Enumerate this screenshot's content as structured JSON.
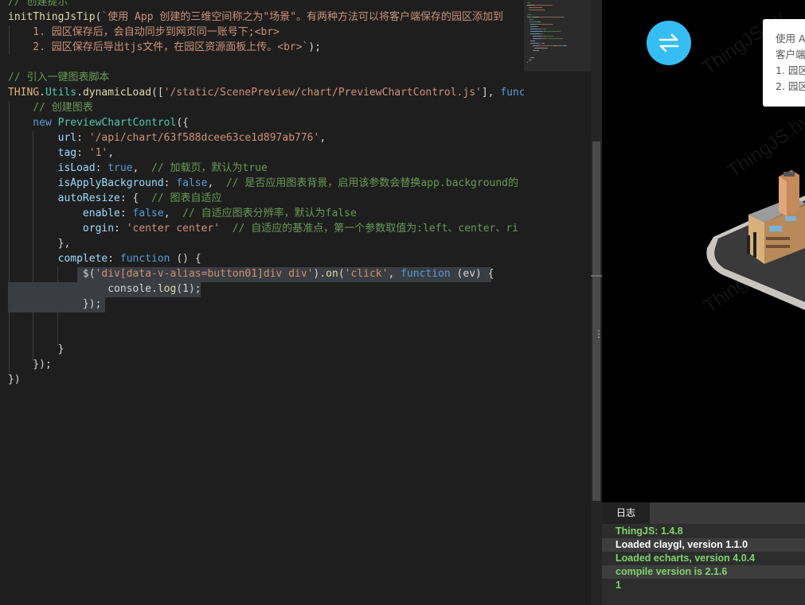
{
  "editor": {
    "lines": [
      [
        {
          "c": "c",
          "t": "// 创建提示"
        }
      ],
      [
        {
          "c": "f",
          "t": "initThingJsTip"
        },
        {
          "c": "",
          "t": "("
        },
        {
          "c": "s",
          "t": "`使用 App 创建的三维空间称之为\"场景\"。有两种方法可以将客户端保存的园区添加到"
        }
      ],
      [
        {
          "c": "s",
          "t": "    1. 园区保存后，会自动同步到网页同一账号下;<br>"
        }
      ],
      [
        {
          "c": "s",
          "t": "    2. 园区保存后导出tjs文件，在园区资源面板上传。<br>`"
        },
        {
          "c": "",
          "t": ");"
        }
      ],
      [
        {
          "c": "",
          "t": ""
        }
      ],
      [
        {
          "c": "c",
          "t": "// 引入一键图表脚本"
        }
      ],
      [
        {
          "c": "o",
          "t": "THING"
        },
        {
          "c": "",
          "t": "."
        },
        {
          "c": "t",
          "t": "Utils"
        },
        {
          "c": "",
          "t": "."
        },
        {
          "c": "f",
          "t": "dynamicLoad"
        },
        {
          "c": "",
          "t": "(["
        },
        {
          "c": "s",
          "t": "'/static/ScenePreview/chart/PreviewChartControl.js'"
        },
        {
          "c": "",
          "t": "], "
        },
        {
          "c": "k",
          "t": "funct"
        }
      ],
      [
        {
          "c": "c",
          "t": "    // 创建图表"
        }
      ],
      [
        {
          "c": "k",
          "t": "    new "
        },
        {
          "c": "t",
          "t": "PreviewChartControl"
        },
        {
          "c": "",
          "t": "({"
        }
      ],
      [
        {
          "c": "v",
          "t": "        url"
        },
        {
          "c": "",
          "t": ": "
        },
        {
          "c": "s",
          "t": "'/api/chart/63f588dcee63ce1d897ab776'"
        },
        {
          "c": "",
          "t": ","
        }
      ],
      [
        {
          "c": "v",
          "t": "        tag"
        },
        {
          "c": "",
          "t": ": "
        },
        {
          "c": "s",
          "t": "'1'"
        },
        {
          "c": "",
          "t": ","
        }
      ],
      [
        {
          "c": "v",
          "t": "        isLoad"
        },
        {
          "c": "",
          "t": ": "
        },
        {
          "c": "k",
          "t": "true"
        },
        {
          "c": "",
          "t": ",  "
        },
        {
          "c": "c",
          "t": "// 加载页，默认为true"
        }
      ],
      [
        {
          "c": "v",
          "t": "        isApplyBackground"
        },
        {
          "c": "",
          "t": ": "
        },
        {
          "c": "k",
          "t": "false"
        },
        {
          "c": "",
          "t": ",  "
        },
        {
          "c": "c",
          "t": "// 是否应用图表背景，启用该参数会替换app.background的"
        }
      ],
      [
        {
          "c": "v",
          "t": "        autoResize"
        },
        {
          "c": "",
          "t": ": {  "
        },
        {
          "c": "c",
          "t": "// 图表自适应"
        }
      ],
      [
        {
          "c": "v",
          "t": "            enable"
        },
        {
          "c": "",
          "t": ": "
        },
        {
          "c": "k",
          "t": "false"
        },
        {
          "c": "",
          "t": ",  "
        },
        {
          "c": "c",
          "t": "// 自适应图表分辨率，默认为false"
        }
      ],
      [
        {
          "c": "v",
          "t": "            orgin"
        },
        {
          "c": "",
          "t": ": "
        },
        {
          "c": "s",
          "t": "'center center'"
        },
        {
          "c": "",
          "t": "  "
        },
        {
          "c": "c",
          "t": "// 自适应的基准点，第一个参数取值为:left、center、ri"
        }
      ],
      [
        {
          "c": "",
          "t": "        },"
        }
      ],
      [
        {
          "c": "v",
          "t": "        complete"
        },
        {
          "c": "",
          "t": ": "
        },
        {
          "c": "k",
          "t": "function"
        },
        {
          "c": "",
          "t": " () {"
        }
      ],
      [
        {
          "c": "",
          "t": "            $("
        },
        {
          "c": "s",
          "t": "'div[data-v-alias=button01]div div'"
        },
        {
          "c": "",
          "t": ")."
        },
        {
          "c": "f",
          "t": "on"
        },
        {
          "c": "",
          "t": "("
        },
        {
          "c": "s",
          "t": "'click'"
        },
        {
          "c": "",
          "t": ", "
        },
        {
          "c": "k",
          "t": "function"
        },
        {
          "c": "",
          "t": " (ev) {"
        }
      ],
      [
        {
          "c": "",
          "t": "                console."
        },
        {
          "c": "f",
          "t": "log"
        },
        {
          "c": "",
          "t": "(1);"
        }
      ],
      [
        {
          "c": "",
          "t": "            });"
        }
      ],
      [
        {
          "c": "",
          "t": ""
        }
      ],
      [
        {
          "c": "",
          "t": ""
        }
      ],
      [
        {
          "c": "",
          "t": "        }"
        }
      ],
      [
        {
          "c": "",
          "t": "    });"
        }
      ],
      [
        {
          "c": "",
          "t": "})"
        }
      ]
    ]
  },
  "preview": {
    "tip": [
      "使用 A",
      "客户端",
      "1. 园区",
      "2. 园区"
    ],
    "watermark": "ThingJS.hy"
  },
  "log": {
    "tab_label": "日志",
    "entries": [
      {
        "text": "ThingJS: 1.4.8",
        "color": "#7ed46b"
      },
      {
        "text": "Loaded claygl, version 1.1.0",
        "color": "#ffffff"
      },
      {
        "text": "Loaded echarts, version 4.0.4",
        "color": "#7ed46b"
      },
      {
        "text": "compile version is 2.1.6",
        "color": "#7ed46b"
      },
      {
        "text": "1",
        "color": "#7ed46b"
      }
    ]
  },
  "colors": {
    "accent": "#36bdf3",
    "log_green": "#7ed46b"
  }
}
